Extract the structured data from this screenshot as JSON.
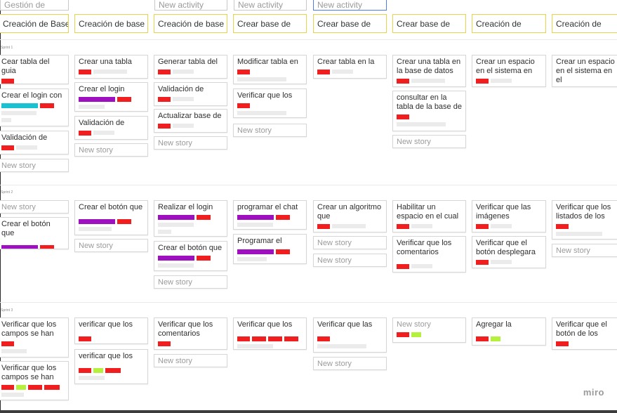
{
  "app": {
    "watermark": "miro"
  },
  "colors": {
    "red": "#f01e1e",
    "purple": "#9e0fc0",
    "cyan": "#1ac2d1",
    "lime": "#b5f03c",
    "placeholder": "#ebebeb"
  },
  "activities": [
    {
      "label": "Gestión de"
    },
    {
      "label": "New activity"
    },
    {
      "label": "New activity"
    },
    {
      "label": "New activity"
    }
  ],
  "releases": [
    "Creación de Base",
    "Creación de base",
    "Creación de base",
    "Crear base de",
    "Crear base de",
    "Crear base de",
    "Creación de",
    "Creación de"
  ],
  "sprints": [
    {
      "label": "Sprint 1"
    },
    {
      "label": "Sprint 2"
    },
    {
      "label": "Sprint 3"
    }
  ],
  "cards": [
    {
      "title": "Cear tabla del guia"
    },
    {
      "title": "Crear el login con"
    },
    {
      "title": "Validación de"
    },
    {
      "title": "New story"
    },
    {
      "title": "Crear una tabla"
    },
    {
      "title": "Crear el login"
    },
    {
      "title": "Validación de"
    },
    {
      "title": "New story"
    },
    {
      "title": "Generar tabla del"
    },
    {
      "title": "Validación de"
    },
    {
      "title": "Actualizar base de"
    },
    {
      "title": "New story"
    },
    {
      "title": "Modificar tabla en"
    },
    {
      "title": "Verificar que los"
    },
    {
      "title": "New story"
    },
    {
      "title": "Crear tabla en la"
    },
    {
      "title": "Crear una tabla en la base de datos"
    },
    {
      "title": "consultar en la tabla de la base de"
    },
    {
      "title": "New story"
    },
    {
      "title": "Crear un espacio en el sistema en"
    },
    {
      "title": "Crear un espacio en el sistema en el"
    },
    {
      "title": "New story"
    },
    {
      "title": "Crear el botón que"
    },
    {
      "title": "Crear el botón que"
    },
    {
      "title": "New story"
    },
    {
      "title": "Realizar el login"
    },
    {
      "title": "Crear el botón que"
    },
    {
      "title": "New story"
    },
    {
      "title": "programar el chat"
    },
    {
      "title": "Programar el"
    },
    {
      "title": "Crear un algoritmo que"
    },
    {
      "title": "New story"
    },
    {
      "title": "New story"
    },
    {
      "title": "Habilitar un espacio en el cual"
    },
    {
      "title": "Verificar que los comentarios"
    },
    {
      "title": "Verificar que las imágenes"
    },
    {
      "title": "Verificar que el botón desplegara"
    },
    {
      "title": "Verificar que los listados de los"
    },
    {
      "title": "New story"
    },
    {
      "title": "Verificar que los campos se han"
    },
    {
      "title": "Verificar que los campos se han"
    },
    {
      "title": "verificar que los"
    },
    {
      "title": "verificar que los"
    },
    {
      "title": "Verificar que los comentarios"
    },
    {
      "title": "New story"
    },
    {
      "title": "Verificar que los"
    },
    {
      "title": "Verificar que las"
    },
    {
      "title": "New story"
    },
    {
      "title": "New story"
    },
    {
      "title": "Agregar la"
    },
    {
      "title": "Verificar que el botón de los"
    }
  ]
}
